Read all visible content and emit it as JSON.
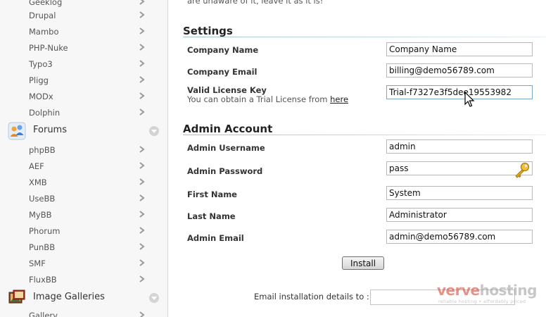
{
  "sidebar": {
    "items_top": [
      {
        "label": "Geeklog"
      },
      {
        "label": "Drupal"
      },
      {
        "label": "Mambo"
      },
      {
        "label": "PHP-Nuke"
      },
      {
        "label": "Typo3"
      },
      {
        "label": "Pligg"
      },
      {
        "label": "MODx"
      },
      {
        "label": "Dolphin"
      }
    ],
    "forums": {
      "label": "Forums",
      "icon": "forums-icon",
      "items": [
        {
          "label": "phpBB"
        },
        {
          "label": "AEF"
        },
        {
          "label": "XMB"
        },
        {
          "label": "UseBB"
        },
        {
          "label": "MyBB"
        },
        {
          "label": "Phorum"
        },
        {
          "label": "PunBB"
        },
        {
          "label": "SMF"
        },
        {
          "label": "FluxBB"
        }
      ]
    },
    "galleries": {
      "label": "Image Galleries",
      "icon": "image-galleries-icon",
      "items": [
        {
          "label": "Gallery"
        }
      ]
    }
  },
  "main": {
    "top_note": "are unaware of it, leave it as it is!",
    "settings": {
      "title": "Settings",
      "company_name_label": "Company Name",
      "company_name_value": "Company Name",
      "company_email_label": "Company Email",
      "company_email_value": "billing@demo56789.com",
      "license_label": "Valid License Key",
      "license_hint": "You can obtain a Trial License from",
      "license_hint_link": "here",
      "license_value": "Trial-f7327e3f5dee19553982"
    },
    "admin": {
      "title": "Admin Account",
      "username_label": "Admin Username",
      "username_value": "admin",
      "password_label": "Admin Password",
      "password_value": "pass",
      "first_name_label": "First Name",
      "first_name_value": "System",
      "last_name_label": "Last Name",
      "last_name_value": "Administrator",
      "email_label": "Admin Email",
      "email_value": "admin@demo56789.com"
    },
    "install_label": "Install",
    "email_details_label": "Email installation details to :",
    "email_details_value": "",
    "logo": {
      "brand_part1": "verve",
      "brand_part2": "hosting",
      "tagline": "reliable hosting • affordably priced"
    }
  },
  "colors": {
    "accent_red": "#d33a26",
    "rule_teal": "#9fc3c8",
    "sidebar_bg": "#f7f7f7"
  }
}
